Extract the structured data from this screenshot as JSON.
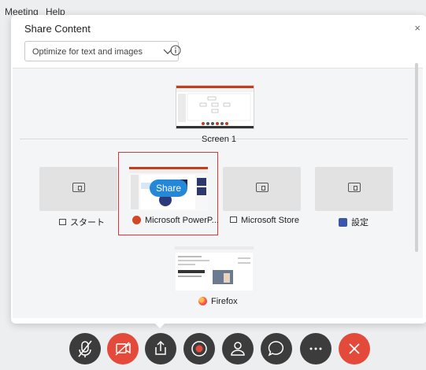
{
  "menubar": {
    "items": [
      "Meeting",
      "Help"
    ]
  },
  "dialog": {
    "title": "Share Content",
    "close_glyph": "×",
    "optimize_select": {
      "selected": "Optimize for text and images"
    },
    "icons": {
      "info": "info-icon",
      "chevron": "chevron-down-icon"
    }
  },
  "screens": [
    {
      "label": "Screen 1"
    }
  ],
  "windows": [
    {
      "label": "スタート",
      "icon": "app-window-icon"
    },
    {
      "label": "Microsoft PowerP...",
      "icon": "powerpoint-icon",
      "selected": true
    },
    {
      "label": "Microsoft Store",
      "icon": "app-window-icon"
    },
    {
      "label": "設定",
      "icon": "settings-icon"
    },
    {
      "label": "Firefox",
      "icon": "firefox-icon"
    }
  ],
  "share_button": {
    "label": "Share"
  },
  "toolbar": {
    "buttons": [
      {
        "name": "mute-mic",
        "icon": "mic-off-icon",
        "color": "#3c3c3c"
      },
      {
        "name": "stop-video",
        "icon": "video-off-icon",
        "color": "#e34a3a"
      },
      {
        "name": "share-content",
        "icon": "share-icon",
        "color": "#3c3c3c"
      },
      {
        "name": "record",
        "icon": "record-icon",
        "color": "#3c3c3c"
      },
      {
        "name": "participants",
        "icon": "participants-icon",
        "color": "#3c3c3c"
      },
      {
        "name": "chat",
        "icon": "chat-icon",
        "color": "#3c3c3c"
      },
      {
        "name": "more-options",
        "icon": "more-icon",
        "color": "#3c3c3c"
      },
      {
        "name": "leave-meeting",
        "icon": "close-icon",
        "color": "#e34a3a"
      }
    ]
  },
  "colors": {
    "selection_border": "#d9383a",
    "share_accent": "#2487d8",
    "danger": "#e34a3a"
  }
}
